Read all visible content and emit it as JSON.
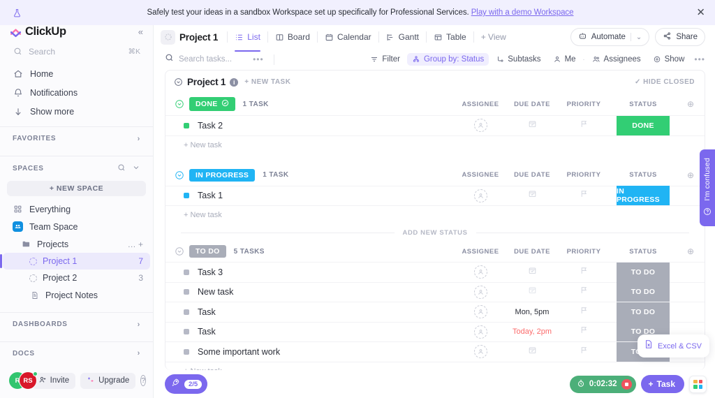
{
  "banner": {
    "icon": "beaker-icon",
    "text": "Safely test your ideas in a sandbox Workspace set up specifically for Professional Services.",
    "link_label": "Play with a demo Workspace",
    "close_label": "✕"
  },
  "sidebar": {
    "logo_text": "ClickUp",
    "collapse_label": "«",
    "search": {
      "placeholder": "Search",
      "shortcut": "⌘K"
    },
    "nav": [
      {
        "label": "Home",
        "icon": "home-icon"
      },
      {
        "label": "Notifications",
        "icon": "bell-icon"
      },
      {
        "label": "Show more",
        "icon": "arrow-down-icon"
      }
    ],
    "favorites": {
      "label": "FAVORITES",
      "chevron": "›"
    },
    "spaces": {
      "label": "SPACES",
      "new_space_label": "+ NEW SPACE"
    },
    "space_items": [
      {
        "label": "Everything",
        "kind": "grid"
      },
      {
        "label": "Team Space",
        "kind": "blue"
      }
    ],
    "tree": [
      {
        "label": "Projects",
        "type": "folder",
        "actions": "…  +"
      },
      {
        "label": "Project 1",
        "type": "list",
        "count": "7",
        "active": true
      },
      {
        "label": "Project 2",
        "type": "list",
        "count": "3",
        "active": false
      },
      {
        "label": "Project Notes",
        "type": "doc",
        "count": "",
        "active": false
      }
    ],
    "dashboards": {
      "label": "DASHBOARDS",
      "chevron": "›"
    },
    "docs": {
      "label": "DOCS",
      "chevron": "›"
    },
    "bottom": {
      "avatar_1": "R",
      "avatar_2": "RS",
      "invite_label": "Invite",
      "upgrade_label": "Upgrade",
      "help_label": "?"
    }
  },
  "viewbar": {
    "project_name": "Project 1",
    "tabs": [
      {
        "label": "List",
        "icon": "list-icon",
        "active": true
      },
      {
        "label": "Board",
        "icon": "board-icon",
        "active": false
      },
      {
        "label": "Calendar",
        "icon": "calendar-icon",
        "active": false
      },
      {
        "label": "Gantt",
        "icon": "gantt-icon",
        "active": false
      },
      {
        "label": "Table",
        "icon": "table-icon",
        "active": false
      }
    ],
    "add_view_label": "+ View",
    "automate_label": "Automate",
    "automate_chevron": "⌄",
    "share_label": "Share"
  },
  "filterbar": {
    "search_placeholder": "Search tasks...",
    "more_label": "•••",
    "items": [
      {
        "label": "Filter",
        "icon": "filter-icon",
        "active": false
      },
      {
        "label": "Group by: Status",
        "icon": "group-icon",
        "active": true
      },
      {
        "label": "Subtasks",
        "icon": "subtasks-icon",
        "active": false
      },
      {
        "label": "Me",
        "icon": "person-icon",
        "active": false
      },
      {
        "label": "Assignees",
        "icon": "people-icon",
        "active": false
      },
      {
        "label": "Show",
        "icon": "eye-icon",
        "active": false
      }
    ],
    "trailing_dots": "•••"
  },
  "list_header": {
    "title": "Project 1",
    "info_glyph": "i",
    "new_task_label": "+ NEW TASK",
    "hide_closed_label": "✓ HIDE CLOSED"
  },
  "columns": {
    "assignee": "ASSIGNEE",
    "due_date": "DUE DATE",
    "priority": "PRIORITY",
    "status": "STATUS",
    "add": "⊕"
  },
  "add_new_status_label": "ADD NEW STATUS",
  "new_task_row_label": "+ New task",
  "groups": [
    {
      "status": "DONE",
      "color": "#32ce74",
      "has_check": true,
      "count_label": "1 TASK",
      "tasks": [
        {
          "name": "Task 2",
          "due": "",
          "due_late": false,
          "status": "DONE"
        }
      ]
    },
    {
      "status": "IN PROGRESS",
      "color": "#20b4f4",
      "has_check": false,
      "count_label": "1 TASK",
      "tasks": [
        {
          "name": "Task 1",
          "due": "",
          "due_late": false,
          "status": "IN PROGRESS"
        }
      ]
    },
    {
      "status": "TO DO",
      "color": "#a9adb8",
      "has_check": false,
      "count_label": "5 TASKS",
      "tasks": [
        {
          "name": "Task 3",
          "due": "",
          "due_late": false,
          "status": "TO DO"
        },
        {
          "name": "New task",
          "due": "",
          "due_late": false,
          "status": "TO DO"
        },
        {
          "name": "Task",
          "due": "Mon, 5pm",
          "due_late": false,
          "status": "TO DO"
        },
        {
          "name": "Task",
          "due": "Today, 2pm",
          "due_late": true,
          "status": "TO DO"
        },
        {
          "name": "Some important work",
          "due": "",
          "due_late": false,
          "status": "TO DO"
        }
      ]
    }
  ],
  "floating": {
    "confused_label": "I'm confused",
    "excel_label": "Excel & CSV"
  },
  "bottom_bar": {
    "rocket_count": "2/5",
    "timer_value": "0:02:32",
    "task_label": "Task",
    "task_plus": "+"
  },
  "colors": {
    "accent": "#7b68ee",
    "done": "#32ce74",
    "in_progress": "#20b4f4",
    "todo": "#a9adb8",
    "overdue": "#fb6b6b",
    "timer_green": "#4caf79"
  }
}
